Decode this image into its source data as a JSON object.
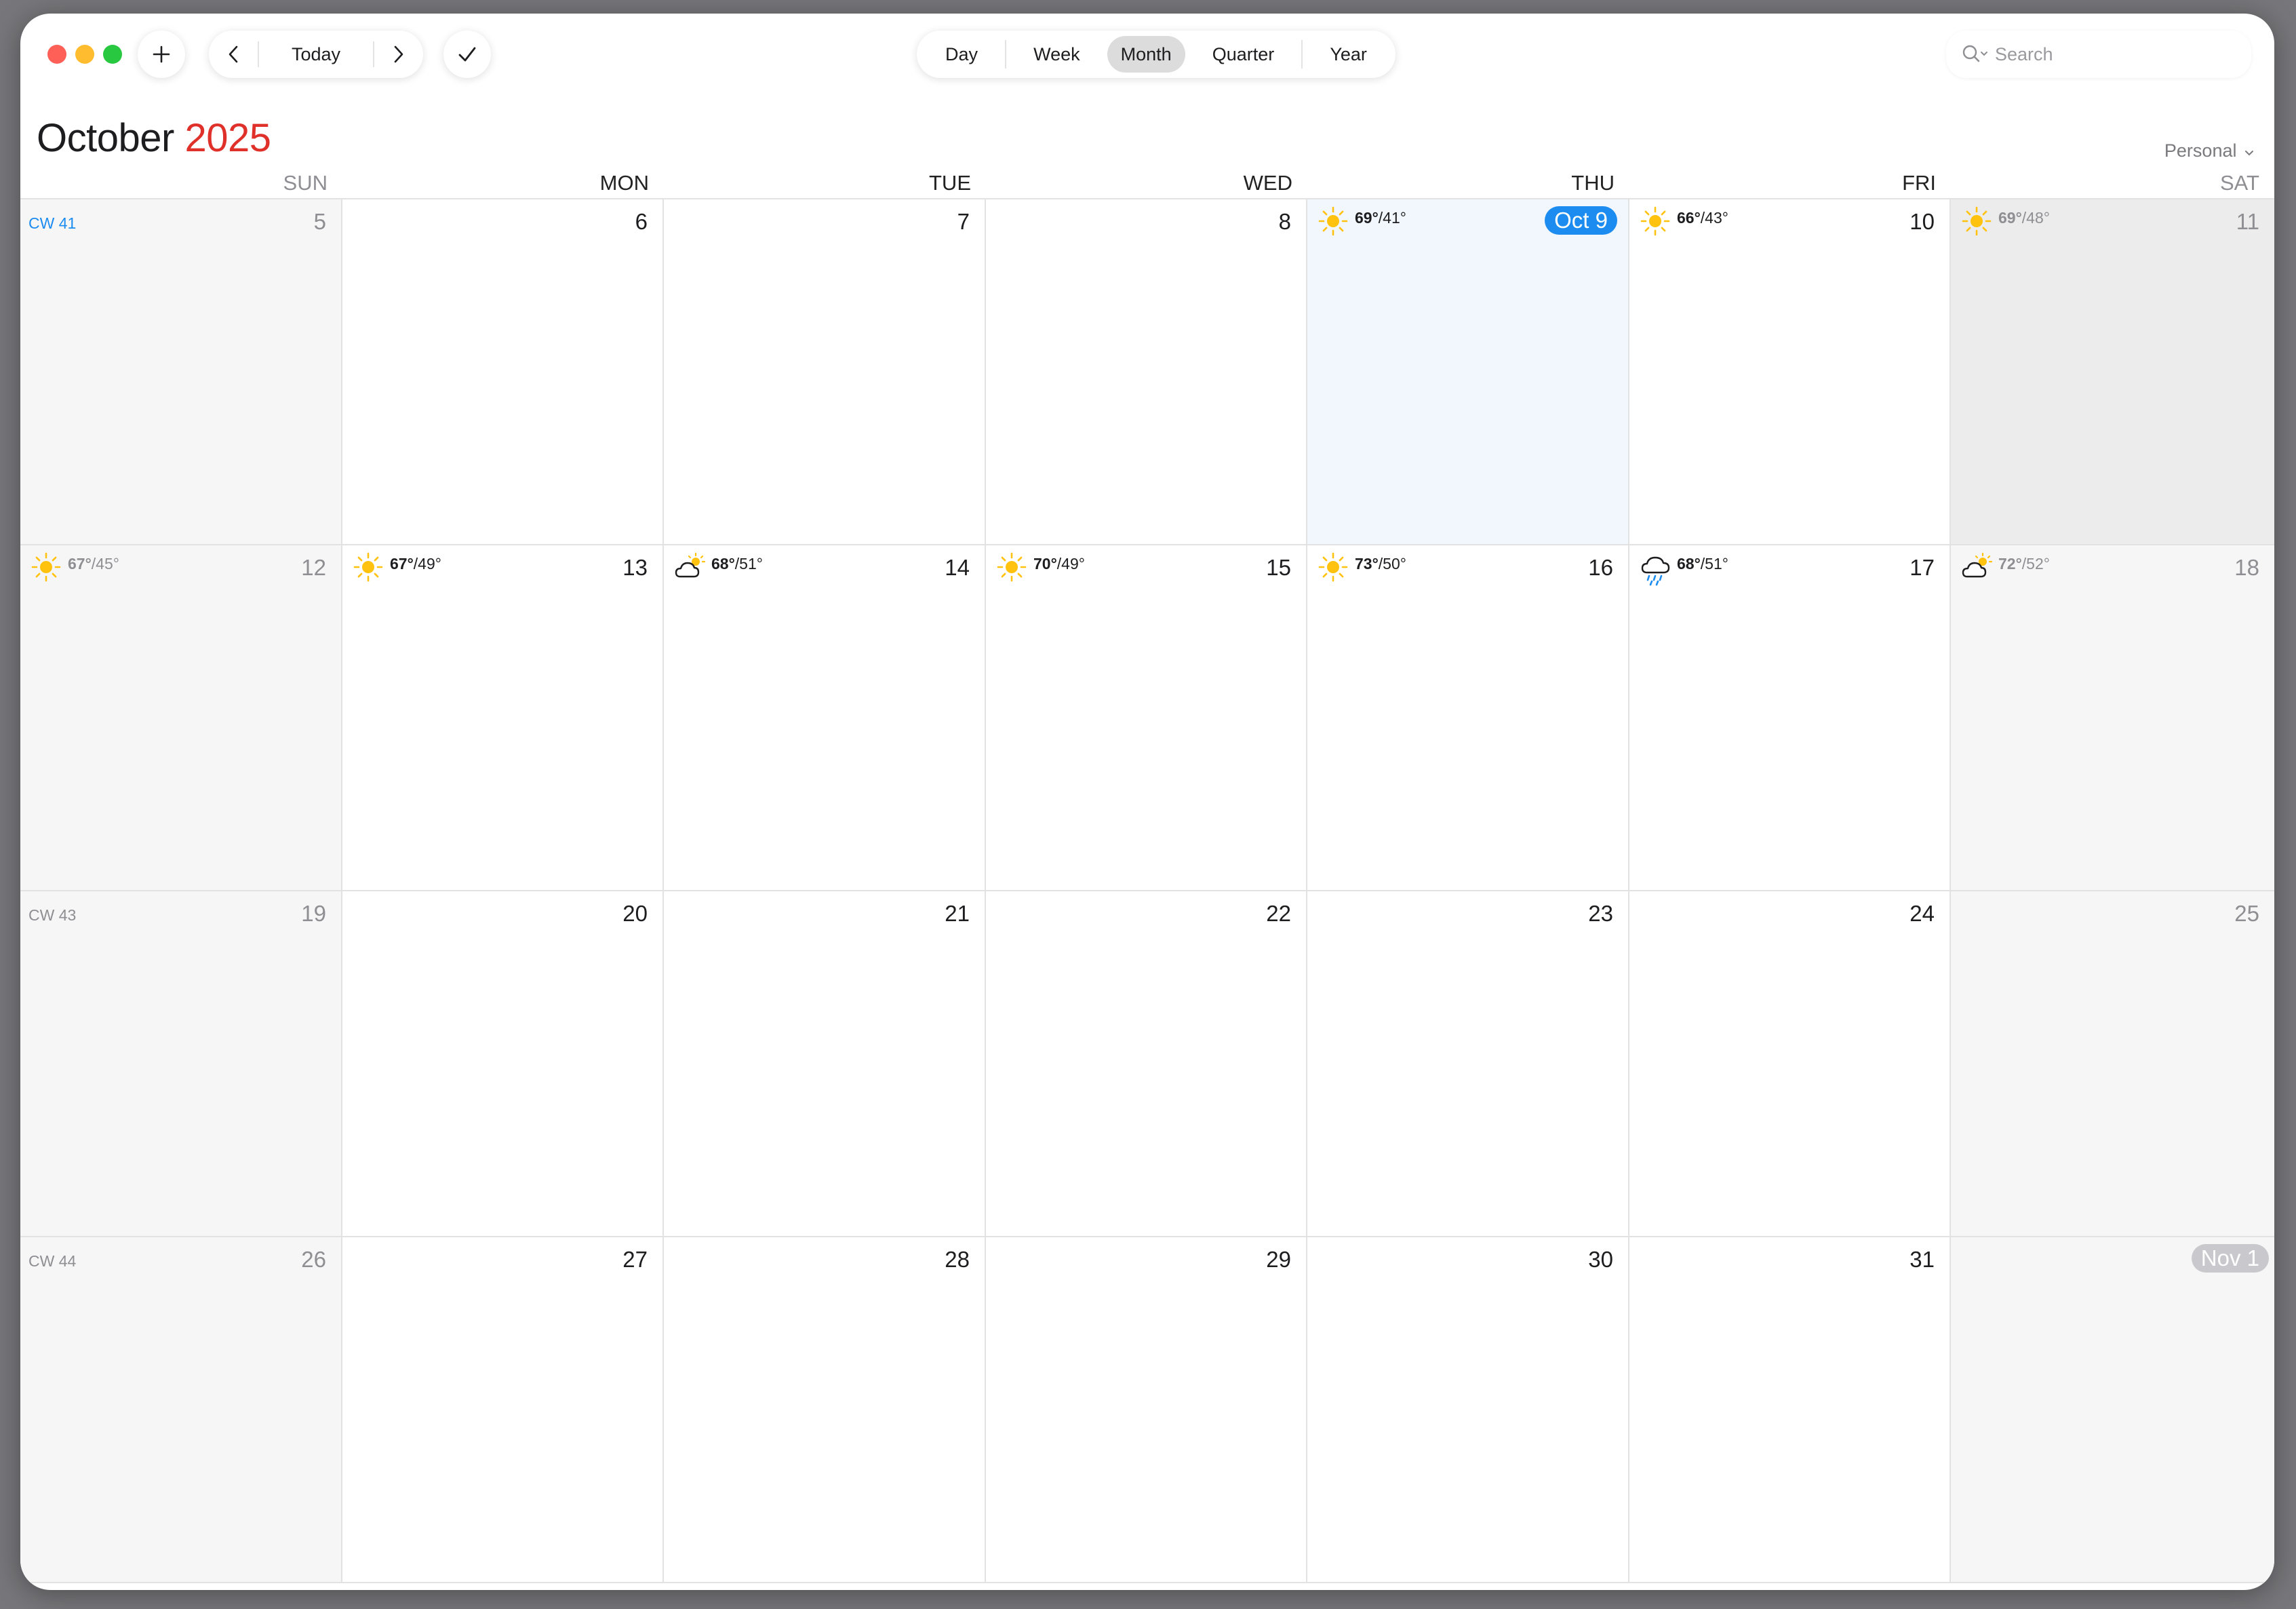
{
  "toolbar": {
    "today_label": "Today",
    "views": [
      "Day",
      "Week",
      "Month",
      "Quarter",
      "Year"
    ],
    "active_view": "Month",
    "search_placeholder": "Search"
  },
  "header": {
    "month": "October",
    "year": "2025",
    "calendar_filter": "Personal"
  },
  "weekdays": [
    "SUN",
    "MON",
    "TUE",
    "WED",
    "THU",
    "FRI",
    "SAT"
  ],
  "colors": {
    "today_badge": "#1c8cf0",
    "year_accent": "#e0302a",
    "sun": "#ffc20e"
  },
  "weeks": [
    {
      "cw": "CW 41",
      "days": [
        {
          "label": "5"
        },
        {
          "label": "6"
        },
        {
          "label": "7"
        },
        {
          "label": "8"
        },
        {
          "label": "Oct 9",
          "today": true,
          "weather": {
            "icon": "sun-icon",
            "hi": "69°",
            "lo": "/41°"
          }
        },
        {
          "label": "10",
          "weather": {
            "icon": "sun-icon",
            "hi": "66°",
            "lo": "/43°"
          }
        },
        {
          "label": "11",
          "weather": {
            "icon": "sun-icon",
            "hi": "69°",
            "lo": "/48°"
          }
        }
      ]
    },
    {
      "cw": "",
      "days": [
        {
          "label": "12",
          "weather": {
            "icon": "sun-icon",
            "hi": "67°",
            "lo": "/45°"
          }
        },
        {
          "label": "13",
          "weather": {
            "icon": "sun-icon",
            "hi": "67°",
            "lo": "/49°"
          }
        },
        {
          "label": "14",
          "weather": {
            "icon": "partly-cloudy-icon",
            "hi": "68°",
            "lo": "/51°"
          }
        },
        {
          "label": "15",
          "weather": {
            "icon": "sun-icon",
            "hi": "70°",
            "lo": "/49°"
          }
        },
        {
          "label": "16",
          "weather": {
            "icon": "sun-icon",
            "hi": "73°",
            "lo": "/50°"
          }
        },
        {
          "label": "17",
          "weather": {
            "icon": "rain-icon",
            "hi": "68°",
            "lo": "/51°"
          }
        },
        {
          "label": "18",
          "weather": {
            "icon": "partly-cloudy-icon",
            "hi": "72°",
            "lo": "/52°"
          }
        }
      ]
    },
    {
      "cw": "CW 43",
      "days": [
        {
          "label": "19"
        },
        {
          "label": "20"
        },
        {
          "label": "21"
        },
        {
          "label": "22"
        },
        {
          "label": "23"
        },
        {
          "label": "24"
        },
        {
          "label": "25"
        }
      ]
    },
    {
      "cw": "CW 44",
      "days": [
        {
          "label": "26"
        },
        {
          "label": "27"
        },
        {
          "label": "28"
        },
        {
          "label": "29"
        },
        {
          "label": "30"
        },
        {
          "label": "31"
        },
        {
          "label": "Nov 1",
          "next_month": true
        }
      ]
    }
  ]
}
